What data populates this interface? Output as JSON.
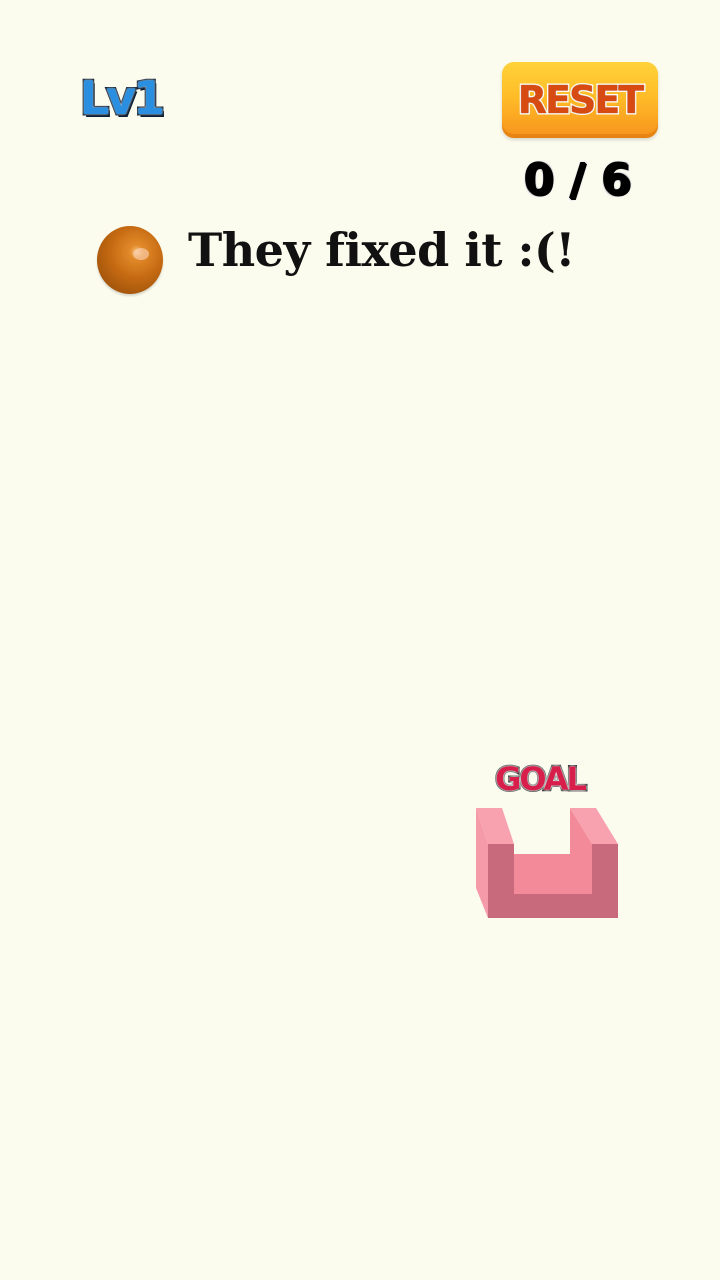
{
  "hud": {
    "level_label": "Lv1",
    "reset_label": "RESET",
    "move_counter": "0 / 6"
  },
  "message": {
    "text": "They fixed it :(!"
  },
  "goal": {
    "label": "GOAL"
  },
  "colors": {
    "background": "#fcfcee",
    "level_text": "#2a8fe0",
    "reset_button": "#ffbd28",
    "reset_text": "#d74a12",
    "goal_text": "#d81e4a",
    "goal_cup": "#f08a9a",
    "ball": "#c56a12"
  }
}
